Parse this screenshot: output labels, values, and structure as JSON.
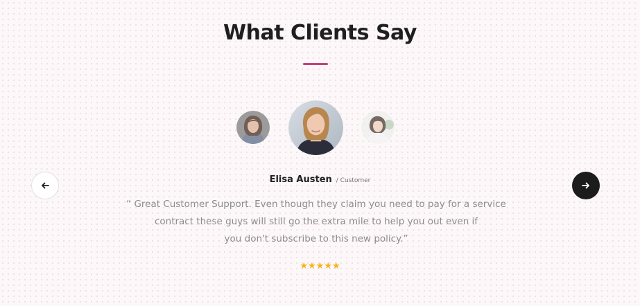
{
  "section": {
    "title": "What Clients Say",
    "accent_color": "#c8407a"
  },
  "testimonial": {
    "name": "Elisa Austen",
    "role": "/ Customer",
    "quote_lines": [
      "“ Great Customer Support. Even though they claim you need to pay for a service",
      "contract these guys will still go the extra mile to help you out even if",
      "you don't subscribe to this new policy.”"
    ],
    "rating": 5,
    "rating_stars": "★★★★★",
    "star_color": "#f3b51c"
  },
  "avatars": [
    {
      "name": "avatar-previous-client",
      "state": "inactive"
    },
    {
      "name": "avatar-elisa-austen",
      "state": "active"
    },
    {
      "name": "avatar-next-client",
      "state": "inactive"
    }
  ],
  "navigation": {
    "prev_icon": "arrow-left-icon",
    "next_icon": "arrow-right-icon"
  }
}
